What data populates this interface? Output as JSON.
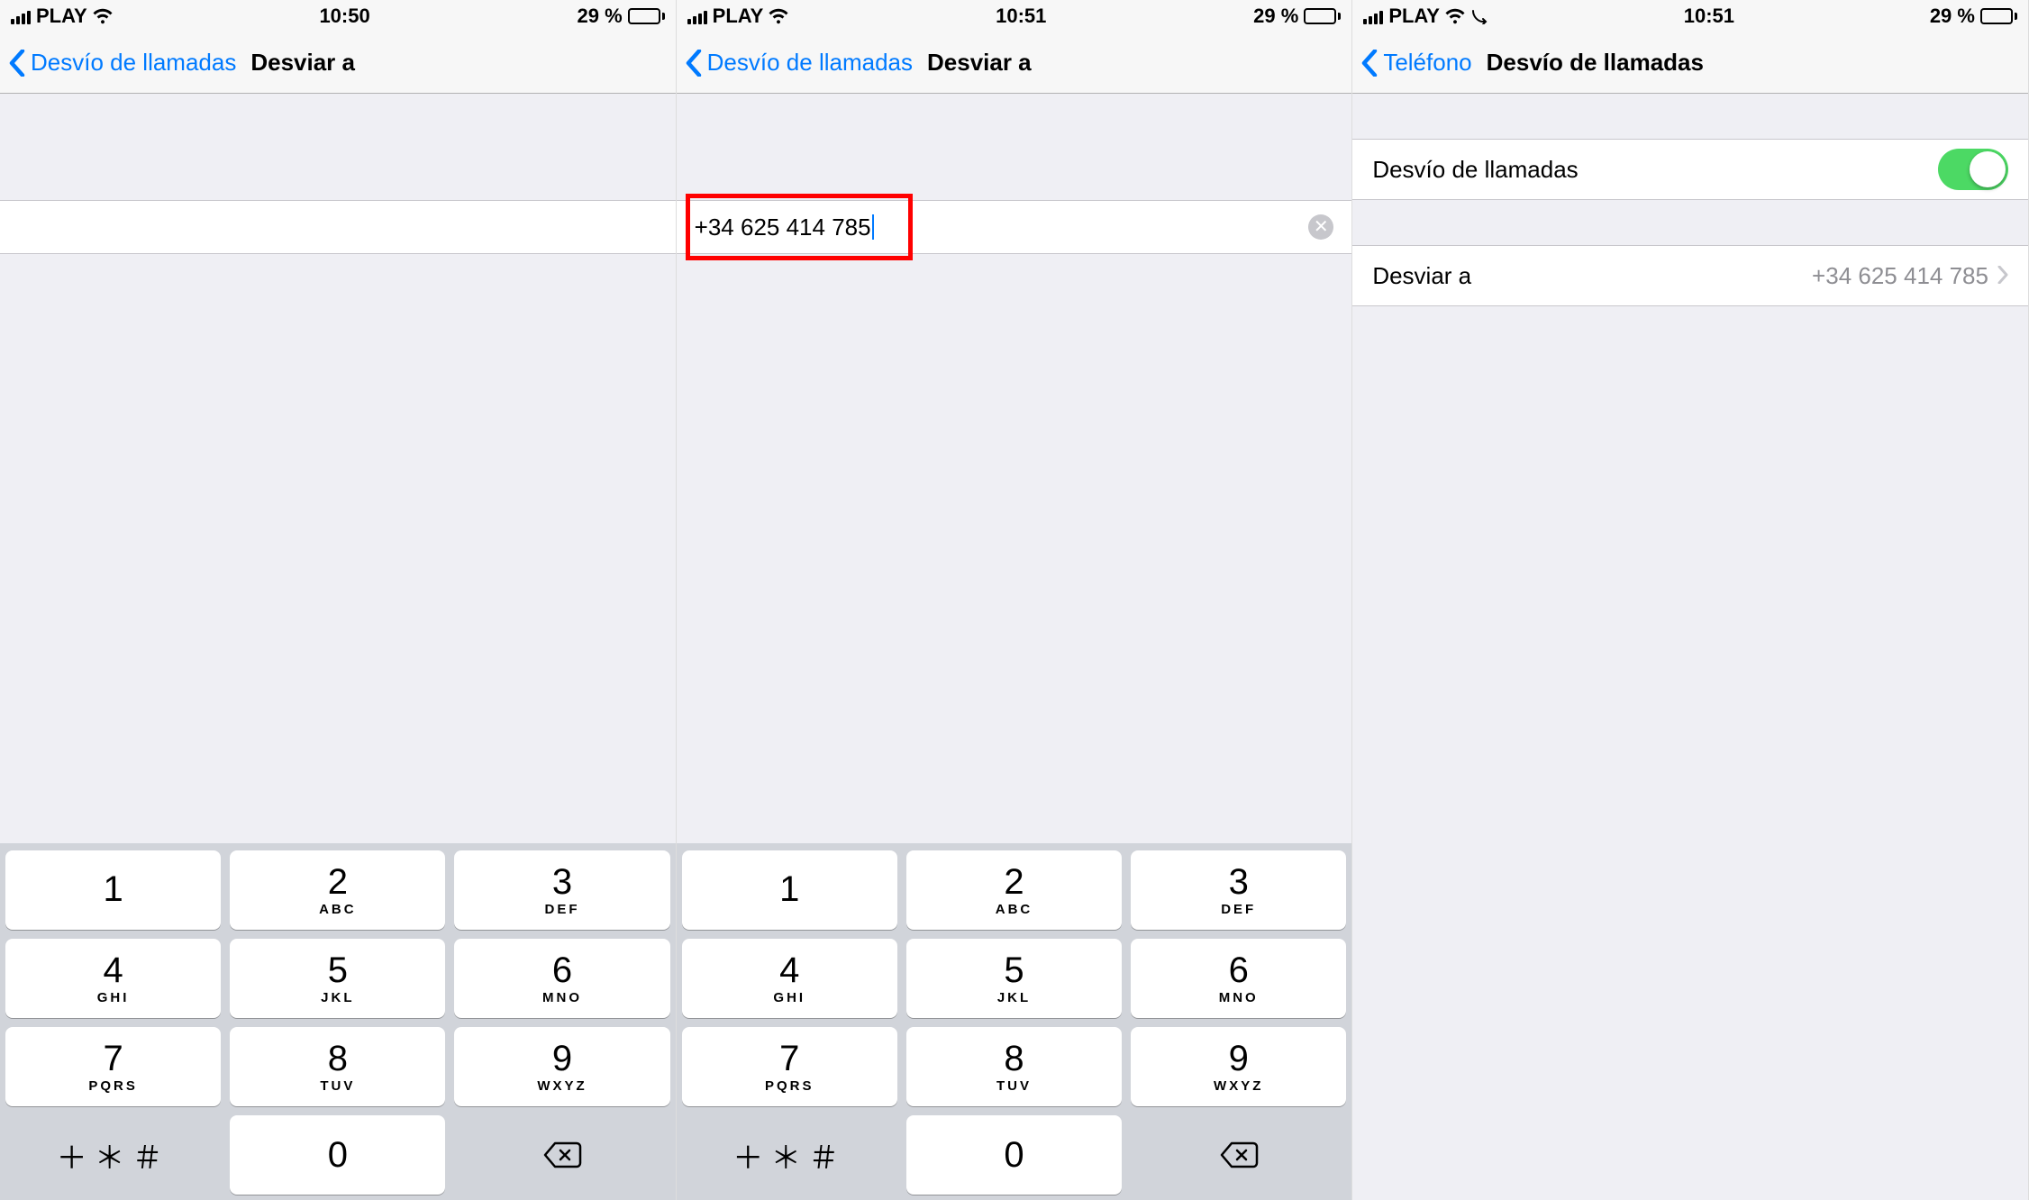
{
  "screens": [
    {
      "status": {
        "carrier": "PLAY",
        "time": "10:50",
        "battery_pct": "29 %",
        "has_fwd_icon": false
      },
      "nav": {
        "back_label": "Desvío de llamadas",
        "title": "Desviar a"
      },
      "input": {
        "value": "",
        "show_clear": false,
        "highlight": false
      },
      "show_keypad": true
    },
    {
      "status": {
        "carrier": "PLAY",
        "time": "10:51",
        "battery_pct": "29 %",
        "has_fwd_icon": false
      },
      "nav": {
        "back_label": "Desvío de llamadas",
        "title": "Desviar a"
      },
      "input": {
        "value": "+34 625 414 785",
        "show_clear": true,
        "highlight": true,
        "show_caret": true
      },
      "show_keypad": true
    },
    {
      "status": {
        "carrier": "PLAY",
        "time": "10:51",
        "battery_pct": "29 %",
        "has_fwd_icon": true
      },
      "nav": {
        "back_label": "Teléfono",
        "title": "Desvío de llamadas"
      },
      "settings": {
        "toggle_label": "Desvío de llamadas",
        "toggle_on": true,
        "forward_label": "Desviar a",
        "forward_value": "+34 625 414 785"
      },
      "show_keypad": false
    }
  ],
  "keypad": {
    "keys": [
      {
        "digit": "1",
        "letters": ""
      },
      {
        "digit": "2",
        "letters": "ABC"
      },
      {
        "digit": "3",
        "letters": "DEF"
      },
      {
        "digit": "4",
        "letters": "GHI"
      },
      {
        "digit": "5",
        "letters": "JKL"
      },
      {
        "digit": "6",
        "letters": "MNO"
      },
      {
        "digit": "7",
        "letters": "PQRS"
      },
      {
        "digit": "8",
        "letters": "TUV"
      },
      {
        "digit": "9",
        "letters": "WXYZ"
      }
    ],
    "symbols": "+ * #",
    "zero": "0",
    "delete": "delete"
  }
}
